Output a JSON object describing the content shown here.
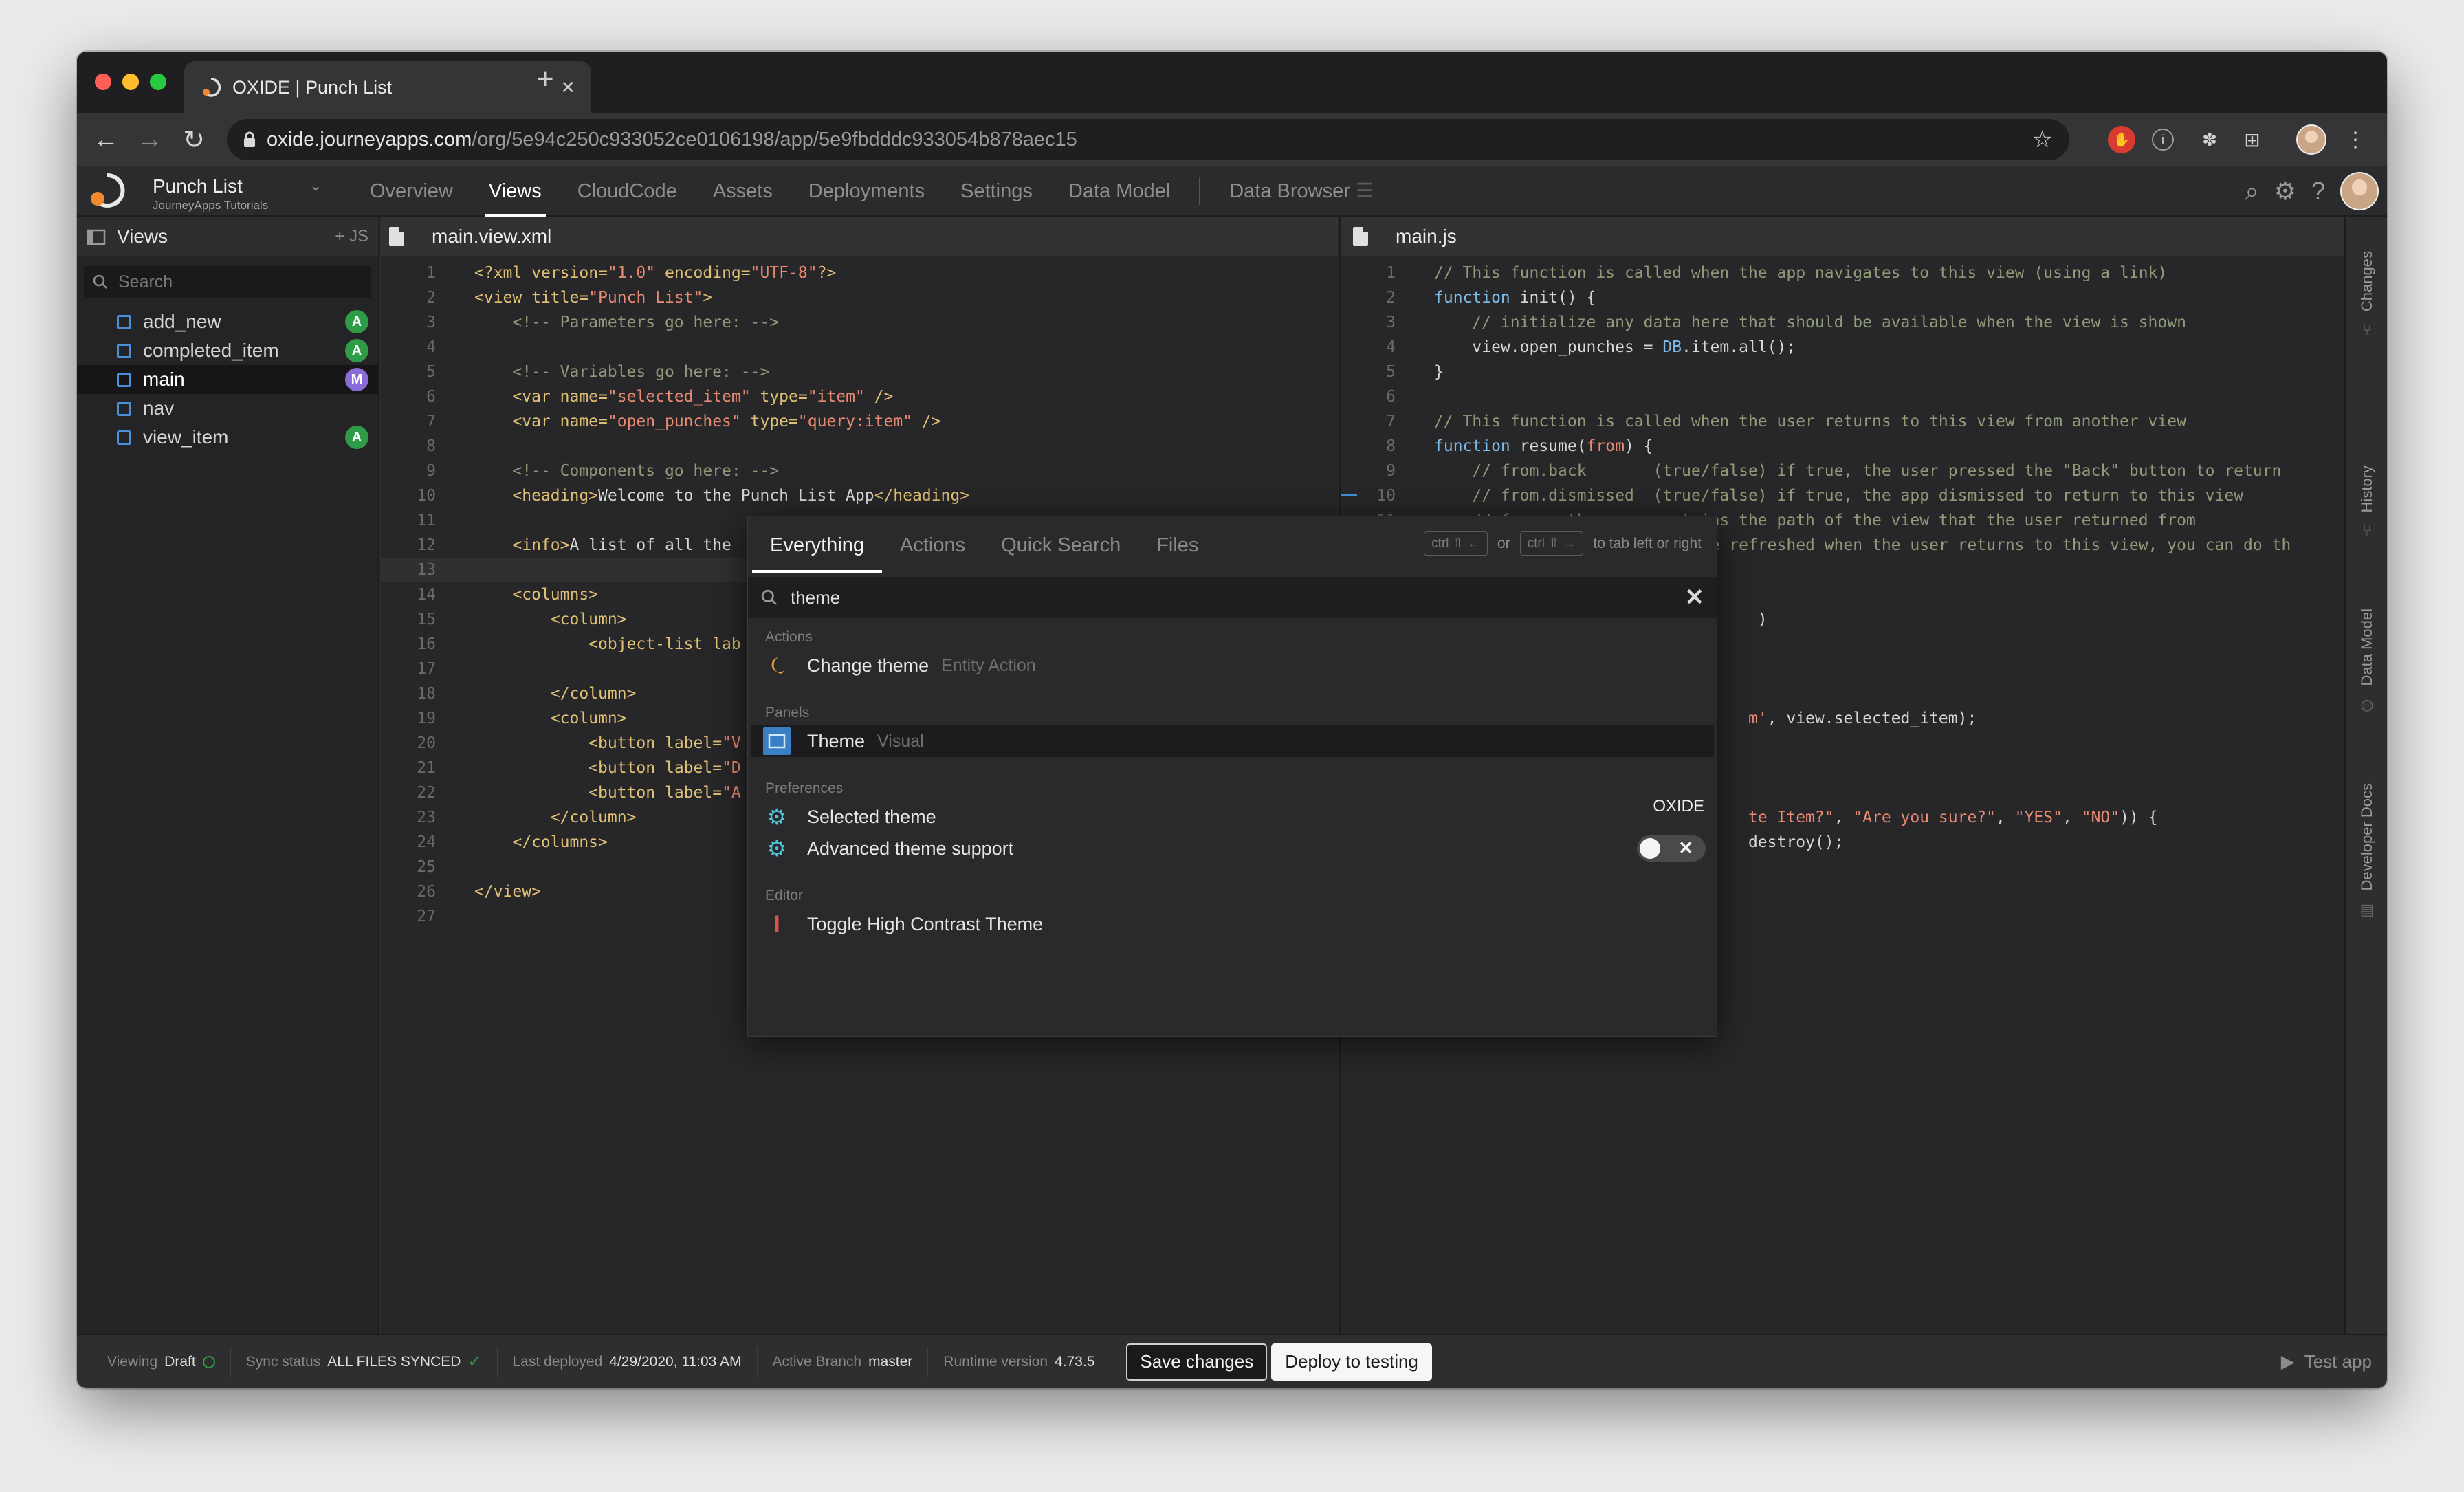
{
  "browser": {
    "tab_title": "OXIDE | Punch List",
    "tab_close": "×",
    "new_tab": "+",
    "url_host": "oxide.journeyapps.com",
    "url_path": "/org/5e94c250c933052ce0106198/app/5e9fbdddc933054b878aec15",
    "icons": [
      "back-arrow-icon",
      "forward-arrow-icon",
      "reload-icon",
      "lock-icon",
      "star-icon",
      "extension-icon",
      "info-icon",
      "puzzle-icon",
      "grid-icon",
      "profile-icon",
      "kebab-menu-icon"
    ]
  },
  "app": {
    "project_name": "Punch List",
    "project_subtitle": "JourneyApps Tutorials",
    "nav_tabs": [
      "Overview",
      "Views",
      "CloudCode",
      "Assets",
      "Deployments",
      "Settings",
      "Data Model"
    ],
    "data_browser": "Data Browser",
    "active_tab": "Views"
  },
  "sidebar": {
    "title": "Views",
    "add_label": "+ JS",
    "search_placeholder": "Search",
    "items": [
      {
        "label": "add_new",
        "badge": "A"
      },
      {
        "label": "completed_item",
        "badge": "A"
      },
      {
        "label": "main",
        "badge": "M"
      },
      {
        "label": "nav",
        "badge": ""
      },
      {
        "label": "view_item",
        "badge": "A"
      }
    ]
  },
  "editor_left": {
    "filename": "main.view.xml",
    "line_numbers": [
      "1",
      "2",
      "3",
      "4",
      "5",
      "6",
      "7",
      "8",
      "9",
      "10",
      "11",
      "12",
      "13",
      "14",
      "15",
      "16",
      "17",
      "18",
      "19",
      "20",
      "21",
      "22",
      "23",
      "24",
      "25",
      "26",
      "27"
    ]
  },
  "editor_right": {
    "filename": "main.js",
    "line_numbers": [
      "1",
      "2",
      "3",
      "4",
      "5",
      "6",
      "7",
      "8",
      "9",
      "10",
      "11"
    ]
  },
  "palette": {
    "tabs": [
      "Everything",
      "Actions",
      "Quick Search",
      "Files"
    ],
    "hint_key1": "ctrl ⇧ ←",
    "hint_or": "or",
    "hint_key2": "ctrl ⇧ →",
    "hint_text": "to tab left or right",
    "query": "theme",
    "sections": {
      "actions": "Actions",
      "panels": "Panels",
      "preferences": "Preferences",
      "editor": "Editor"
    },
    "rows": {
      "change_theme": {
        "label": "Change theme",
        "sub": "Entity Action"
      },
      "theme_panel": {
        "label": "Theme",
        "sub": "Visual"
      },
      "selected_theme": {
        "label": "Selected theme",
        "value": "OXIDE"
      },
      "advanced_theme": {
        "label": "Advanced theme support",
        "toggle": "off"
      },
      "high_contrast": {
        "label": "Toggle High Contrast Theme"
      }
    }
  },
  "right_rail": [
    "Changes",
    "History",
    "Data Model",
    "Developer Docs"
  ],
  "statusbar": {
    "viewing_k": "Viewing",
    "viewing_v": "Draft",
    "sync_k": "Sync status",
    "sync_v": "ALL FILES SYNCED",
    "deployed_k": "Last deployed",
    "deployed_v": "4/29/2020, 11:03 AM",
    "branch_k": "Active Branch",
    "branch_v": "master",
    "runtime_k": "Runtime version",
    "runtime_v": "4.73.5",
    "save_label": "Save changes",
    "deploy_label": "Deploy to testing",
    "test_label": "Test app"
  },
  "colors": {
    "accent": "#4a90d9",
    "badge_a": "#2e9c46",
    "badge_m": "#8a6cd8",
    "theme_icon": "#f0a030",
    "settings_icon": "#4fc3d9",
    "cursor_icon": "#e05050"
  }
}
